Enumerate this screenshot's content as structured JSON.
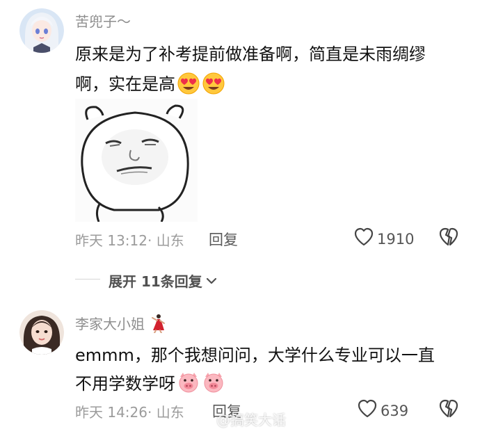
{
  "comments": [
    {
      "username": "苦兜子～",
      "text_line1": "原来是为了补考提前做准备啊，简直是未雨绸缪",
      "text_line2": "啊，实在是高",
      "emojis": [
        "heart-eyes-emoji",
        "heart-eyes-emoji"
      ],
      "timestamp": "昨天 13:12· 山东",
      "reply_label": "回复",
      "like_count": "1910"
    },
    {
      "username": "李家大小姐",
      "text_line1": "emmm，那个我想问问，大学什么专业可以一直",
      "text_line2": "不用学数学呀",
      "emojis": [
        "pig-face-emoji",
        "pig-face-emoji"
      ],
      "timestamp": "昨天 14:26· 山东",
      "reply_label": "回复",
      "like_count": "639"
    }
  ],
  "expand_replies": {
    "label": "展开 11条回复"
  },
  "watermark": "@搞笑大话",
  "colors": {
    "username": "#8e8e8e",
    "text": "#111111",
    "meta": "#9b9b9b"
  }
}
